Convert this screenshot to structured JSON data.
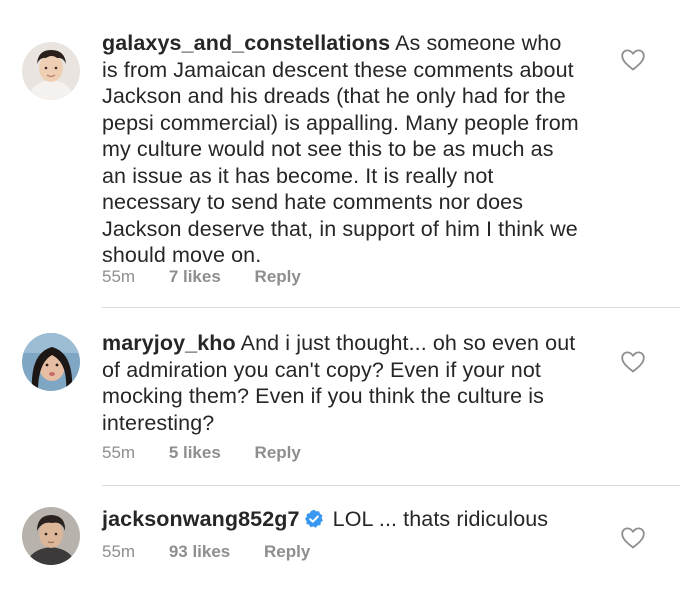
{
  "comments": [
    {
      "username": "galaxys_and_constellations",
      "text": " As someone who is from Jamaican descent these comments about Jackson and his dreads (that he only had for the pepsi commercial) is appalling. Many people from my culture would not see this to be as much as an issue as it has become. It is really not necessary to send hate comments nor does Jackson deserve that, in support of him I think we should move on.",
      "time": "55m",
      "likes": "7 likes",
      "reply": "Reply",
      "verified": false
    },
    {
      "username": "maryjoy_kho",
      "text": " And i just thought... oh so even out of admiration you can't copy? Even if  your not mocking them? Even if you think the culture is interesting?",
      "time": "55m",
      "likes": "5 likes",
      "reply": "Reply",
      "verified": false
    },
    {
      "username": "jacksonwang852g7",
      "text": " LOL ... thats ridiculous",
      "time": "55m",
      "likes": "93 likes",
      "reply": "Reply",
      "verified": true
    }
  ],
  "colors": {
    "text": "#262626",
    "meta": "#8e8e8e",
    "divider": "#dbdbdb",
    "verified": "#3897f0"
  }
}
